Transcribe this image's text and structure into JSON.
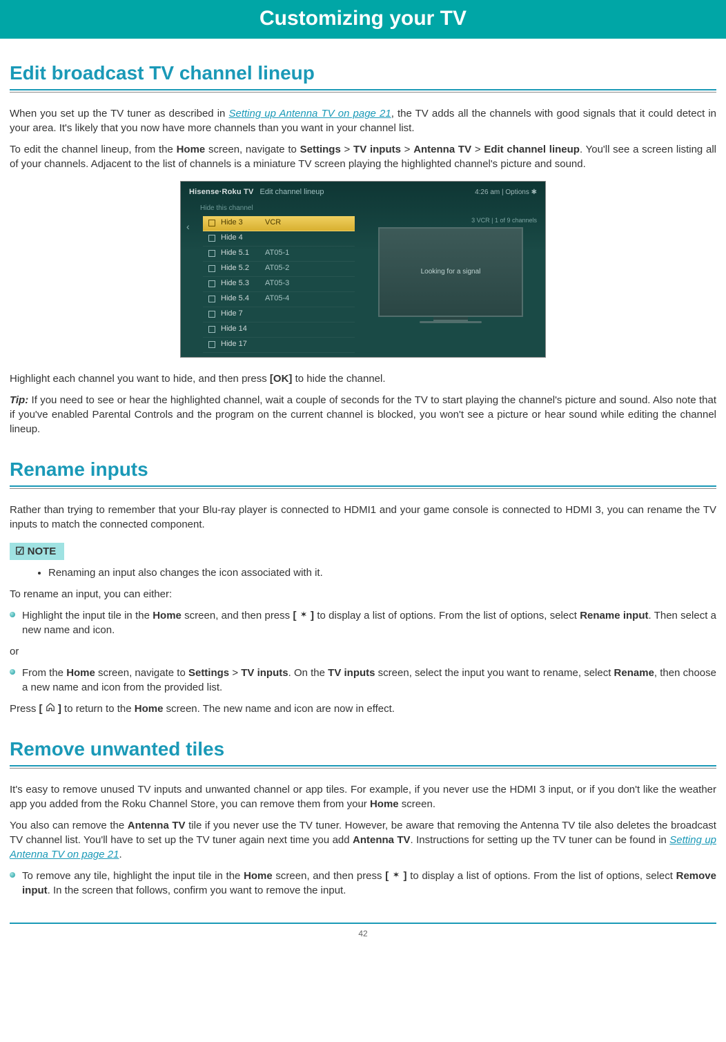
{
  "banner": "Customizing your TV",
  "page_number": "42",
  "section1": {
    "heading": "Edit broadcast TV channel lineup",
    "p1_pre": "When you set up the TV tuner as described in ",
    "p1_link": "Setting up Antenna TV on page 21",
    "p1_post": ", the TV adds all the channels with good signals that it could detect in your area. It's likely that you now have more channels than you want in your channel list.",
    "p2_pre": "To edit the channel lineup, from the ",
    "p2_home": "Home",
    "p2_mid1": " screen, navigate to ",
    "p2_settings": "Settings",
    "p2_gt1": " > ",
    "p2_tvinputs": "TV inputs",
    "p2_gt2": " > ",
    "p2_antenna": "Antenna TV",
    "p2_gt3": " > ",
    "p2_edit": "Edit channel lineup",
    "p2_post": ". You'll see a screen listing all of your channels. Adjacent to the list of channels is a miniature TV screen playing the highlighted channel's picture and sound.",
    "p3_pre": "Highlight each channel you want to hide, and then press ",
    "p3_ok": "[OK]",
    "p3_post": " to hide the channel.",
    "tip_label": "Tip:",
    "tip_body": " If you need to see or hear the highlighted channel, wait a couple of seconds for the TV to start playing the channel's picture and sound. Also note that if you've enabled Parental Controls and the program on the current channel is blocked, you won't see a picture or hear sound while editing the channel lineup."
  },
  "screenshot": {
    "brand": "Hisense",
    "brand2": "Roku TV",
    "title": "Edit channel lineup",
    "time": "4:26 am  |  Options ✱",
    "subhead": "Hide this channel",
    "preview_label": "3   VCR | 1 of 9 channels",
    "preview_text": "Looking for a signal",
    "rows": [
      {
        "ch": "Hide 3",
        "lab": "VCR",
        "selected": true
      },
      {
        "ch": "Hide 4",
        "lab": "",
        "selected": false
      },
      {
        "ch": "Hide 5.1",
        "lab": "AT05-1",
        "selected": false
      },
      {
        "ch": "Hide 5.2",
        "lab": "AT05-2",
        "selected": false
      },
      {
        "ch": "Hide 5.3",
        "lab": "AT05-3",
        "selected": false
      },
      {
        "ch": "Hide 5.4",
        "lab": "AT05-4",
        "selected": false
      },
      {
        "ch": "Hide 7",
        "lab": "",
        "selected": false
      },
      {
        "ch": "Hide 14",
        "lab": "",
        "selected": false
      },
      {
        "ch": "Hide 17",
        "lab": "",
        "selected": false
      }
    ]
  },
  "section2": {
    "heading": "Rename inputs",
    "p1": "Rather than trying to remember that your Blu-ray player is connected to HDMI1 and your game console is connected to HDMI 3, you can rename the TV inputs to match the connected component.",
    "note_label": "NOTE",
    "note_item": "Renaming an input also changes the icon associated with it.",
    "p2": "To rename an input, you can either:",
    "bullet1_pre": "Highlight the input tile in the ",
    "bullet1_home": "Home",
    "bullet1_mid1": " screen, and then press ",
    "bullet1_btn": "[ ✱ ]",
    "bullet1_mid2": " to display a list of options. From the list of options, select ",
    "bullet1_rename": "Rename input",
    "bullet1_post": ". Then select a new name and icon.",
    "or": "or",
    "bullet2_pre": "From the ",
    "bullet2_home": "Home",
    "bullet2_mid1": " screen, navigate to ",
    "bullet2_settings": "Settings",
    "bullet2_gt": " > ",
    "bullet2_tvinputs": "TV inputs",
    "bullet2_mid2": ". On the ",
    "bullet2_tvinputs2": "TV inputs",
    "bullet2_mid3": " screen, select the input you want to rename, select ",
    "bullet2_rename": "Rename",
    "bullet2_post": ", then choose a new name and icon from the provided list.",
    "p3_pre": "Press ",
    "p3_btn": "[ ⌂ ]",
    "p3_mid": " to return to the ",
    "p3_home": "Home",
    "p3_post": " screen. The new name and icon are now in effect."
  },
  "section3": {
    "heading": "Remove unwanted tiles",
    "p1_pre": "It's easy to remove unused TV inputs and unwanted channel or app tiles. For example, if you never use the HDMI 3 input, or if you don't like the weather app you added from the Roku Channel Store, you can remove them from your ",
    "p1_home": "Home",
    "p1_post": " screen.",
    "p2_pre": "You also can remove the ",
    "p2_ant1": "Antenna TV",
    "p2_mid1": " tile if you never use the TV tuner. However, be aware that removing the Antenna TV tile also deletes the broadcast TV channel list. You'll have to set up the TV tuner again next time you add ",
    "p2_ant2": "Antenna TV",
    "p2_mid2": ". Instructions for setting up the TV tuner can be found in ",
    "p2_link": "Setting up Antenna TV on page 21",
    "p2_post": ".",
    "bullet_pre": "To remove any tile, highlight the input tile in the ",
    "bullet_home": "Home",
    "bullet_mid1": " screen, and then press ",
    "bullet_btn": "[ ✱ ]",
    "bullet_mid2": " to display a list of options. From the list of options, select ",
    "bullet_remove": "Remove input",
    "bullet_post": ". In the screen that follows, confirm you want to remove the input."
  }
}
